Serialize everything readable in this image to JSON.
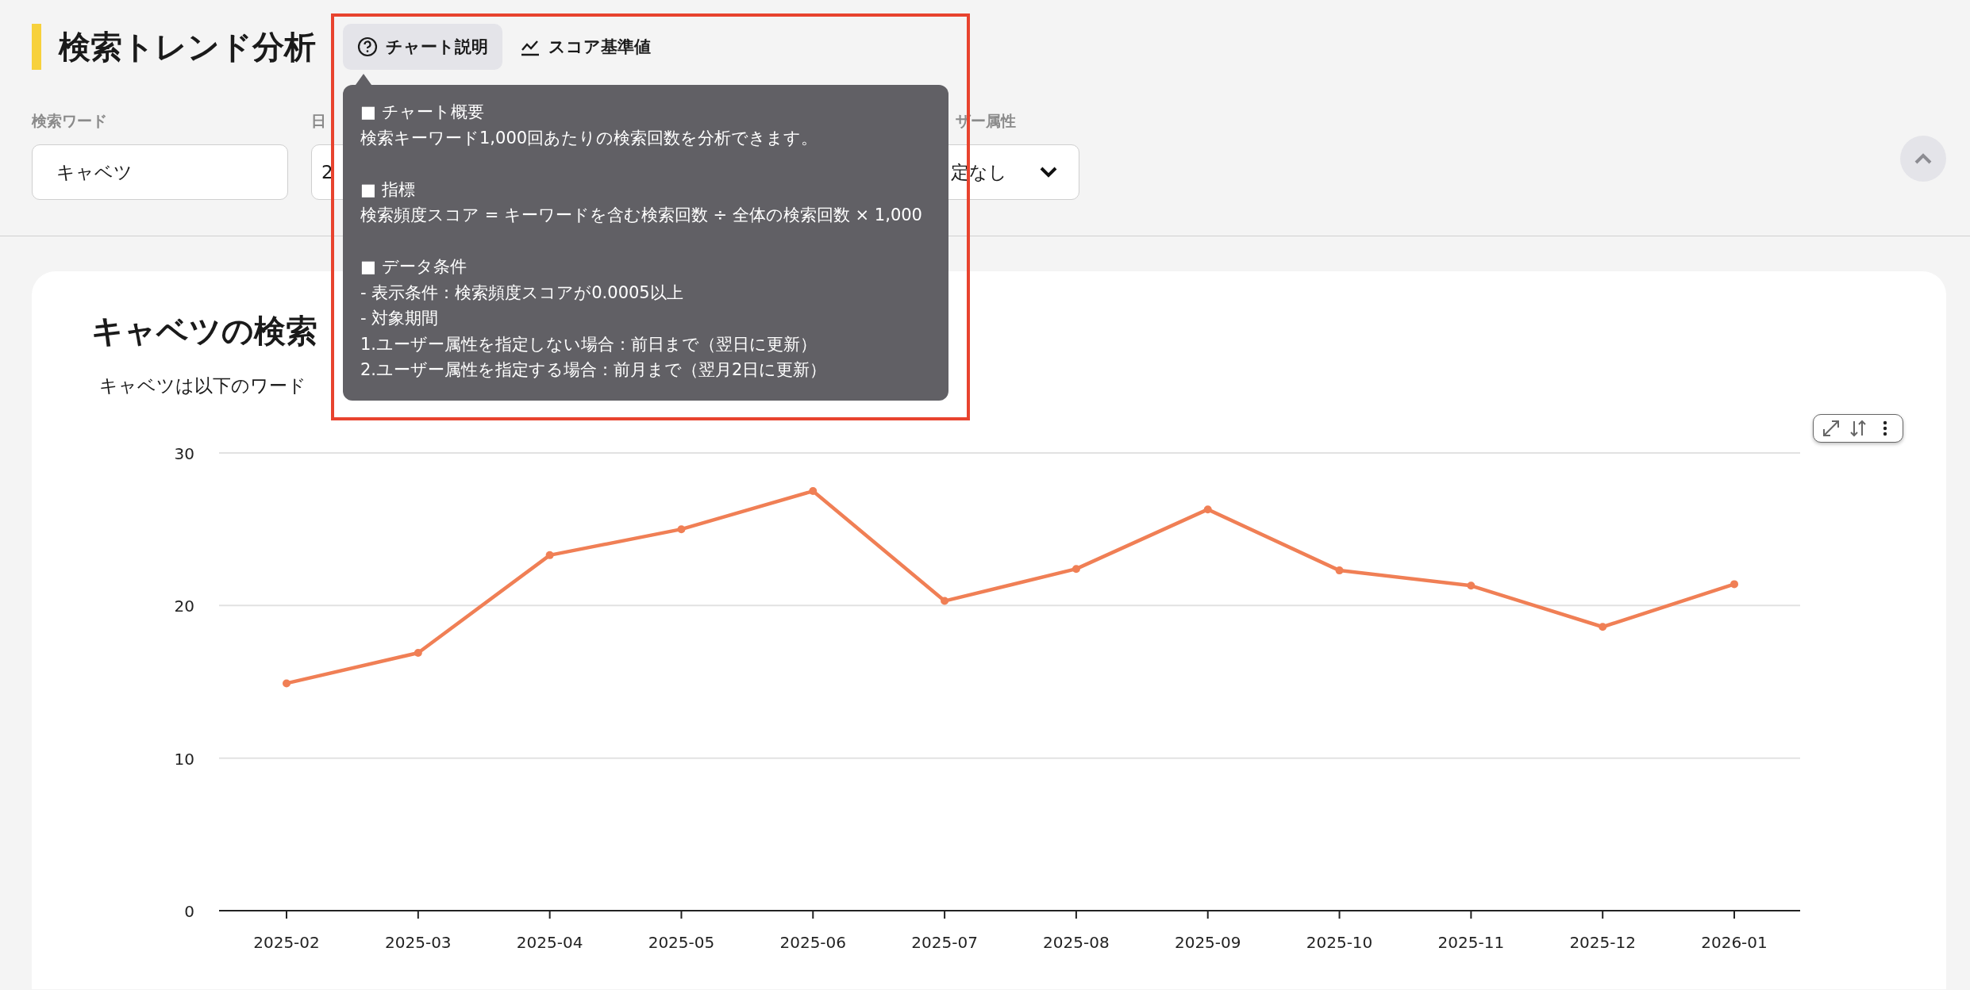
{
  "page": {
    "title": "検索トレンド分析"
  },
  "tabs": [
    {
      "label": "チャート説明",
      "selected": true
    },
    {
      "label": "スコア基準値",
      "selected": false
    }
  ],
  "tooltip": {
    "sections": [
      {
        "heading": "■ チャート概要",
        "lines": [
          "検索キーワード1,000回あたりの検索回数を分析できます。"
        ]
      },
      {
        "heading": "■ 指標",
        "lines": [
          "検索頻度スコア = キーワードを含む検索回数 ÷ 全体の検索回数 × 1,000"
        ]
      },
      {
        "heading": "■ データ条件",
        "lines": [
          "- 表示条件：検索頻度スコアが0.0005以上",
          "- 対象期間",
          "1.ユーザー属性を指定しない場合：前日まで（翌日に更新）",
          "2.ユーザー属性を指定する場合：前月まで（翌月2日に更新）"
        ]
      }
    ]
  },
  "filters": [
    {
      "label": "検索ワード",
      "value": "キャベツ",
      "kind": "text"
    },
    {
      "label": "日",
      "value": "2",
      "kind": "text"
    },
    {
      "label": "ザー属性",
      "value": "定なし",
      "kind": "select"
    }
  ],
  "collapse_button": {
    "expanded": true
  },
  "highlight_frame": true,
  "chart_card": {
    "title": "キャベツの検索",
    "subtitle": "キャベツは以下のワード",
    "chart_data": {
      "type": "line",
      "categories": [
        "2025-02",
        "2025-03",
        "2025-04",
        "2025-05",
        "2025-06",
        "2025-07",
        "2025-08",
        "2025-09",
        "2025-10",
        "2025-11",
        "2025-12",
        "2026-01"
      ],
      "series": [
        {
          "color": "#f07f55",
          "marker": true,
          "values": [
            14.9,
            16.9,
            23.3,
            25.0,
            27.5,
            20.3,
            22.4,
            26.3,
            22.3,
            21.3,
            18.6,
            21.4
          ]
        }
      ],
      "ylim": [
        0,
        30
      ],
      "yticks": [
        0,
        10,
        20,
        30
      ]
    }
  }
}
